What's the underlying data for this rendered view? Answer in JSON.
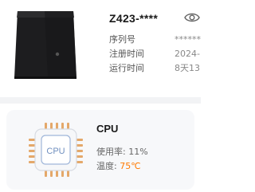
{
  "device": {
    "name": "Z423-****",
    "fields": [
      {
        "label": "序列号",
        "value": "******"
      },
      {
        "label": "注册时间",
        "value": "2024-"
      },
      {
        "label": "运行时间",
        "value": "8天13"
      }
    ]
  },
  "cpu": {
    "title": "CPU",
    "chip_label": "CPU",
    "usage_label": "使用率:",
    "usage_value": "11%",
    "temp_label": "温度:",
    "temp_value": "75℃",
    "accent_color": "#ff7a00"
  },
  "icons": {
    "visibility": "eye-icon",
    "device": "nas-device-image",
    "chip": "cpu-chip-icon"
  }
}
